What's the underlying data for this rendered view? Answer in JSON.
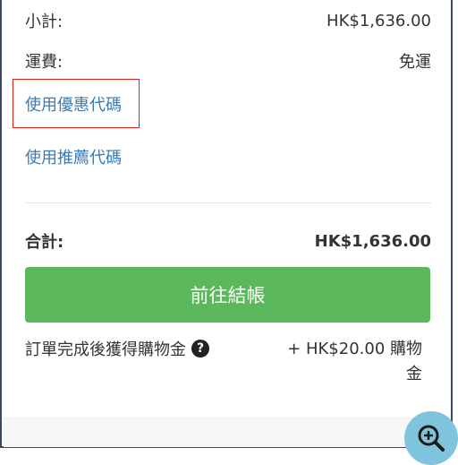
{
  "summary": {
    "subtotal_label": "小計:",
    "subtotal_value": "HK$1,636.00",
    "shipping_label": "運費:",
    "shipping_value": "免運"
  },
  "links": {
    "coupon": "使用優惠代碼",
    "referral": "使用推薦代碼"
  },
  "total": {
    "label": "合計:",
    "value": "HK$1,636.00"
  },
  "checkout": {
    "label": "前往結帳"
  },
  "reward": {
    "label": "訂單完成後獲得購物金",
    "value_line1": "+ HK$20.00 購物",
    "value_line2": "金",
    "help_glyph": "?"
  },
  "icons": {
    "help": "question-circle-icon",
    "zoom": "zoom-in-icon"
  },
  "colors": {
    "link": "#3a7bb5",
    "checkout_button": "#5cb85c",
    "highlight_border": "#e2231a",
    "zoom_button": "#7fc4dc"
  }
}
